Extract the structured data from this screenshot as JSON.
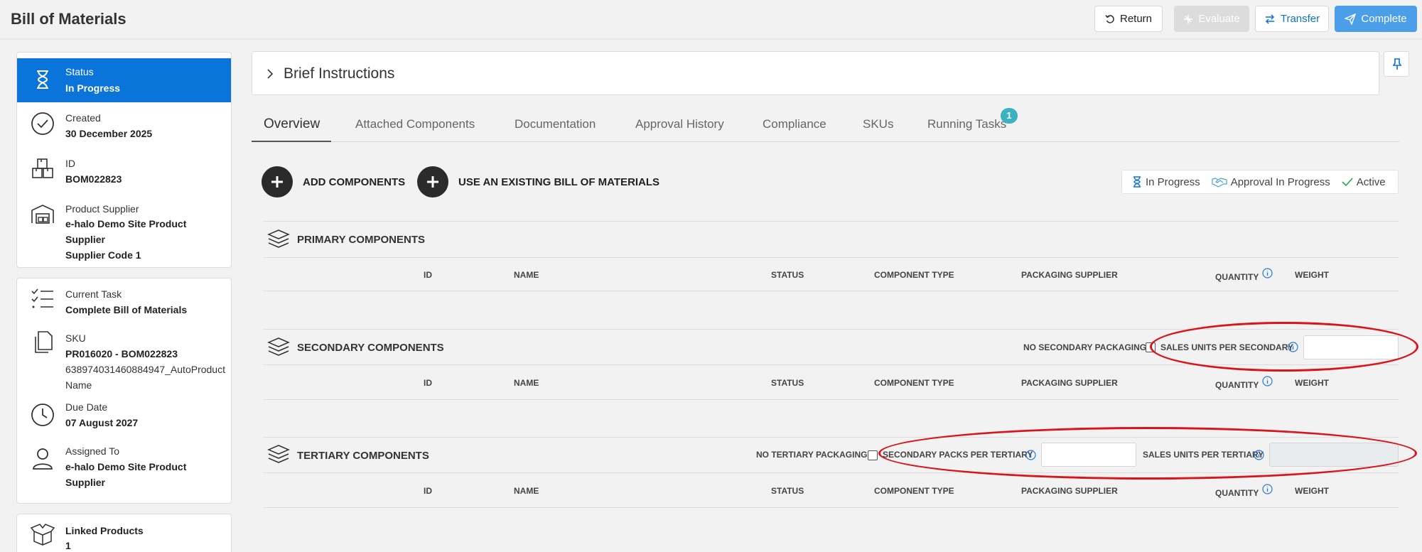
{
  "header": {
    "title": "Bill of Materials",
    "buttons": {
      "return": "Return",
      "evaluate": "Evaluate",
      "transfer": "Transfer",
      "complete": "Complete"
    }
  },
  "colors": {
    "accent": "#0a74da",
    "complete_button": "#4a9fe8",
    "badge": "#3ab2c0",
    "annotation": "#d9141a"
  },
  "sidebar": {
    "card1": {
      "status": {
        "label": "Status",
        "value": "In Progress"
      },
      "created": {
        "label": "Created",
        "value": "30 December 2025"
      },
      "id": {
        "label": "ID",
        "value": "BOM022823"
      },
      "supplier": {
        "label": "Product Supplier",
        "value_line1": "e-halo Demo Site Product",
        "value_line2": "Supplier",
        "value_line3": "Supplier Code 1"
      }
    },
    "card2": {
      "task": {
        "label": "Current Task",
        "value": "Complete Bill of Materials"
      },
      "sku": {
        "label": "SKU",
        "value": "PR016020 - BOM022823",
        "sub_line1": "638974031460884947_AutoProduct",
        "sub_line2": "Name"
      },
      "due": {
        "label": "Due Date",
        "value": "07 August 2027"
      },
      "assigned": {
        "label": "Assigned To",
        "value_line1": "e-halo Demo Site Product",
        "value_line2": "Supplier"
      }
    },
    "card3": {
      "linked": {
        "label": "Linked Products",
        "value": "1"
      }
    }
  },
  "brief": {
    "title": "Brief Instructions"
  },
  "tabs": [
    "Overview",
    "Attached Components",
    "Documentation",
    "Approval History",
    "Compliance",
    "SKUs",
    "Running Tasks"
  ],
  "running_tasks_badge": "1",
  "actions": {
    "add": "ADD COMPONENTS",
    "use_existing": "USE AN EXISTING BILL OF MATERIALS"
  },
  "legend": {
    "in_progress": "In Progress",
    "approval": "Approval In Progress",
    "active": "Active"
  },
  "columns": {
    "id": "ID",
    "name": "NAME",
    "status": "STATUS",
    "type": "COMPONENT TYPE",
    "supplier": "PACKAGING SUPPLIER",
    "quantity": "QUANTITY",
    "weight": "WEIGHT"
  },
  "sections": {
    "primary": {
      "title": "PRIMARY COMPONENTS"
    },
    "secondary": {
      "title": "SECONDARY COMPONENTS",
      "no_packaging": "NO SECONDARY PACKAGING",
      "units_label": "SALES UNITS PER SECONDARY",
      "units_value": ""
    },
    "tertiary": {
      "title": "TERTIARY COMPONENTS",
      "no_packaging": "NO TERTIARY PACKAGING",
      "packs_label": "SECONDARY PACKS PER TERTIARY",
      "packs_value": "",
      "units_label": "SALES UNITS PER TERTIARY",
      "units_value": ""
    }
  }
}
